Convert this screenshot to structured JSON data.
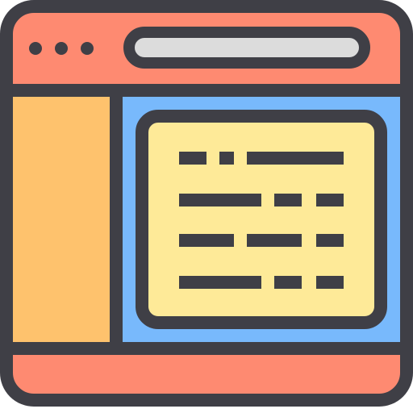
{
  "icon": {
    "name": "browser-window-document-icon",
    "colors": {
      "outline": "#3f3f46",
      "title_bar": "#fe8a71",
      "sidebar": "#fec26d",
      "content_area": "#78b9fc",
      "document": "#feea98",
      "address_bar": "#dcdcdc",
      "window_dots": "#3f3f46",
      "text_lines": "#3f3f46"
    }
  }
}
